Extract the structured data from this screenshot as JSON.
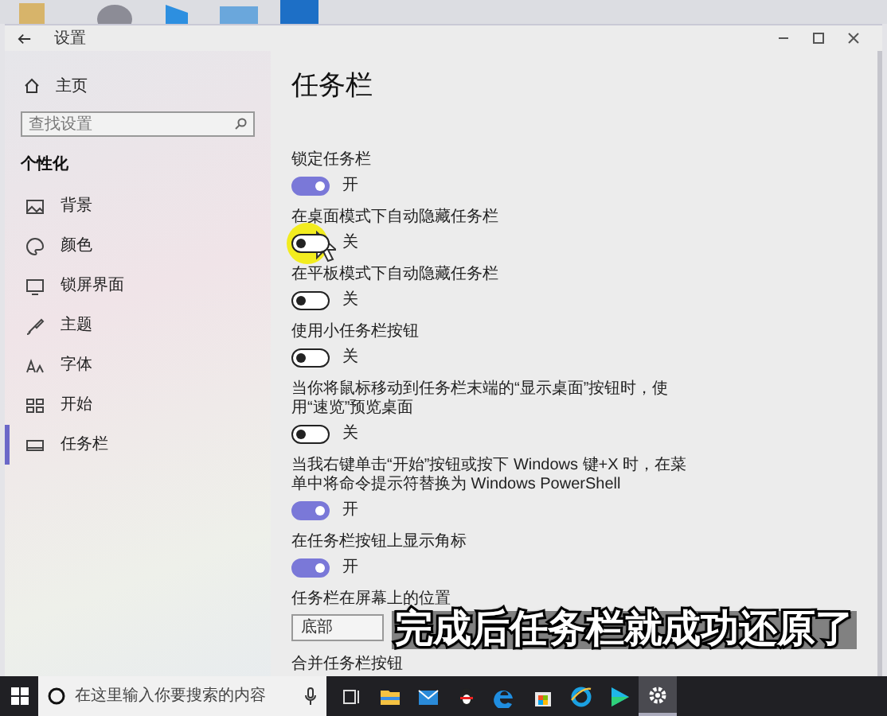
{
  "window": {
    "title": "设置"
  },
  "sidebar": {
    "home": "主页",
    "search": {
      "placeholder": "查找设置"
    },
    "section": "个性化",
    "items": [
      {
        "label": "背景",
        "selected": false
      },
      {
        "label": "颜色",
        "selected": false
      },
      {
        "label": "锁屏界面",
        "selected": false
      },
      {
        "label": "主题",
        "selected": false
      },
      {
        "label": "字体",
        "selected": false
      },
      {
        "label": "开始",
        "selected": false
      },
      {
        "label": "任务栏",
        "selected": true
      }
    ]
  },
  "main": {
    "title": "任务栏",
    "settings": [
      {
        "kind": "toggle",
        "label": "锁定任务栏",
        "on": true,
        "state_text": "开",
        "highlighted": false
      },
      {
        "kind": "toggle",
        "label": "在桌面模式下自动隐藏任务栏",
        "on": false,
        "state_text": "关",
        "highlighted": true
      },
      {
        "kind": "toggle",
        "label": "在平板模式下自动隐藏任务栏",
        "on": false,
        "state_text": "关",
        "highlighted": false
      },
      {
        "kind": "toggle",
        "label": "使用小任务栏按钮",
        "on": false,
        "state_text": "关",
        "highlighted": false
      },
      {
        "kind": "toggle",
        "label": "当你将鼠标移动到任务栏末端的“显示桌面”按钮时，使用“速览”预览桌面",
        "on": false,
        "state_text": "关",
        "highlighted": false
      },
      {
        "kind": "toggle",
        "label": "当我右键单击“开始”按钮或按下 Windows 键+X 时，在菜单中将命令提示符替换为 Windows PowerShell",
        "on": true,
        "state_text": "开",
        "highlighted": false
      },
      {
        "kind": "toggle",
        "label": "在任务栏按钮上显示角标",
        "on": true,
        "state_text": "开",
        "highlighted": false
      },
      {
        "kind": "dropdown",
        "label": "任务栏在屏幕上的位置",
        "value": "底部"
      },
      {
        "kind": "heading",
        "label": "合并任务栏按钮"
      }
    ]
  },
  "taskbar": {
    "search": {
      "placeholder": "在这里输入你要搜索的内容"
    },
    "apps": [
      {
        "selected": false
      },
      {
        "selected": false
      },
      {
        "selected": false
      },
      {
        "selected": false
      },
      {
        "selected": false
      },
      {
        "selected": false
      },
      {
        "selected": false
      },
      {
        "selected": false
      },
      {
        "selected": true
      }
    ]
  },
  "caption": "完成后任务栏就成功还原了"
}
